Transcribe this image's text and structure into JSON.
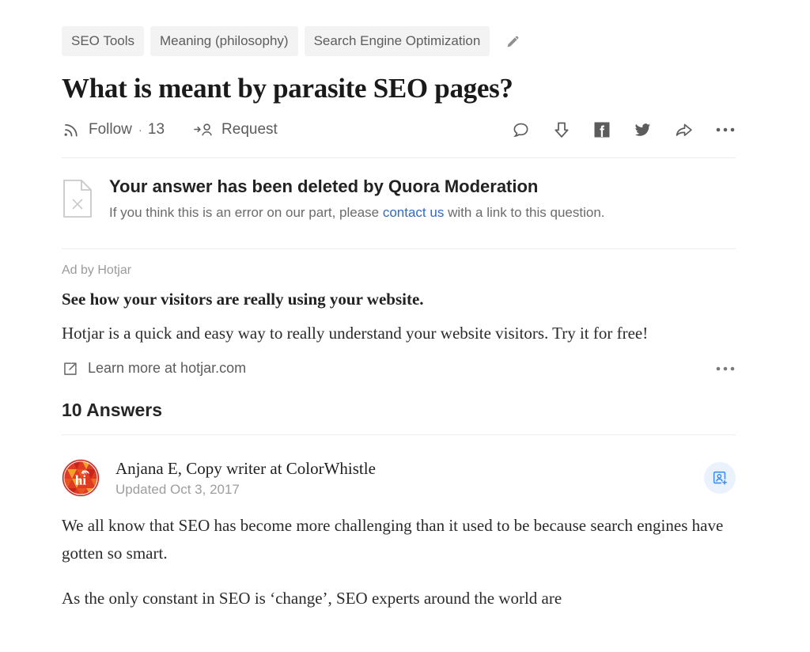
{
  "topics": {
    "pills": [
      {
        "label": "SEO Tools"
      },
      {
        "label": "Meaning (philosophy)"
      },
      {
        "label": "Search Engine Optimization"
      }
    ],
    "edit_icon": "pencil-icon"
  },
  "question": {
    "title": "What is meant by parasite SEO pages?"
  },
  "actions": {
    "follow_label": "Follow",
    "follow_separator": "·",
    "follow_count": "13",
    "request_label": "Request",
    "follow_icon": "rss-follow-icon",
    "request_icon": "person-arrow-icon",
    "share_icons": [
      {
        "name": "comment-icon"
      },
      {
        "name": "downvote-icon"
      },
      {
        "name": "facebook-icon"
      },
      {
        "name": "twitter-icon"
      },
      {
        "name": "share-arrow-icon"
      },
      {
        "name": "more-options-icon"
      }
    ]
  },
  "notice": {
    "icon": "document-deleted-icon",
    "title": "Your answer has been deleted by Quora Moderation",
    "sub_before": "If you think this is an error on our part, please ",
    "link_text": "contact us",
    "sub_after": " with a link to this question.",
    "link_color": "#2b6cc4"
  },
  "ad": {
    "ad_by": "Ad by Hotjar",
    "headline": "See how your visitors are really using your website.",
    "body": "Hotjar is a quick and easy way to really understand your website visitors. Try it for free!",
    "cta_label": "Learn more at hotjar.com",
    "cta_icon": "external-link-icon",
    "more_icon": "more-options-icon"
  },
  "answers": {
    "header": "10 Answers",
    "items": [
      {
        "avatar": "hi-avatar",
        "avatar_text": "hi",
        "author": "Anjana E, Copy writer at ColorWhistle",
        "updated": "Updated Oct 3, 2017",
        "follow_badge_icon": "add-person-icon",
        "paragraphs": [
          "We all know that SEO has become more challenging than it used to be because search engines have gotten so smart.",
          "As the only constant in SEO is ‘change’, SEO experts around the world are"
        ]
      }
    ]
  },
  "colors": {
    "pill_bg": "#f3f3f3",
    "text_primary": "#1a1a1a",
    "text_muted": "#9a9a9a",
    "link_blue": "#2b6cc4",
    "badge_bg": "#e9f2fd",
    "badge_blue": "#3f8ef0",
    "divider": "#ededed"
  }
}
